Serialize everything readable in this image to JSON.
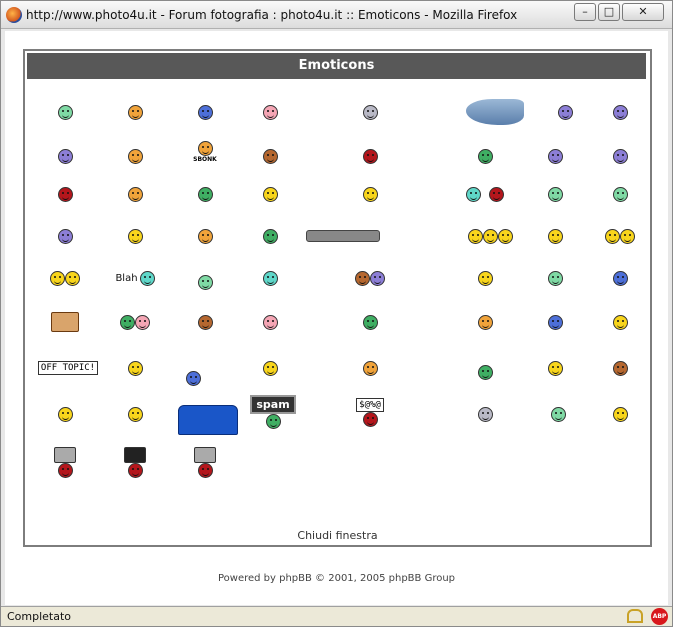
{
  "window": {
    "title": "http://www.photo4u.it - Forum fotografia : photo4u.it :: Emoticons - Mozilla Firefox",
    "min_glyph": "–",
    "max_glyph": "□",
    "close_glyph": "✕"
  },
  "panel": {
    "header": "Emoticons",
    "close_link": "Chiudi finestra"
  },
  "footer": {
    "powered_by": "Powered by phpBB © 2001, 2005 phpBB Group"
  },
  "status": {
    "text": "Completato",
    "abp_label": "ABP"
  },
  "emoticon_text": {
    "blah": "Blah",
    "sbonk": "SBONK",
    "off_topic": "OFF TOPIC!",
    "spam": "spam",
    "swear": "$@%@"
  },
  "colors": {
    "header_bg": "#585858",
    "abp": "#d8181c"
  }
}
